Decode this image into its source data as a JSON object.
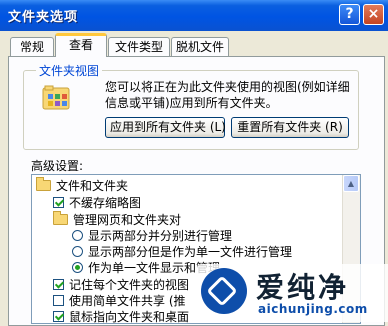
{
  "window": {
    "title": "文件夹选项",
    "help_glyph": "?",
    "close_glyph": "×"
  },
  "tabs": [
    {
      "label": "常规"
    },
    {
      "label": "查看"
    },
    {
      "label": "文件类型"
    },
    {
      "label": "脱机文件"
    }
  ],
  "active_tab": 1,
  "folder_views": {
    "legend": "文件夹视图",
    "description": "您可以将正在为此文件夹使用的视图(例如详细信息或平铺)应用到所有文件夹。",
    "apply_button": "应用到所有文件夹 (L)",
    "reset_button": "重置所有文件夹 (R)"
  },
  "advanced": {
    "label": "高级设置:",
    "items": [
      {
        "type": "folder",
        "label": "文件和文件夹",
        "indent": 0
      },
      {
        "type": "checkbox",
        "label": "不缓存缩略图",
        "checked": true,
        "indent": 1
      },
      {
        "type": "folder",
        "label": "管理网页和文件夹对",
        "indent": 1
      },
      {
        "type": "radio",
        "label": "显示两部分并分别进行管理",
        "checked": false,
        "indent": 2
      },
      {
        "type": "radio",
        "label": "显示两部分但是作为单一文件进行管理",
        "checked": false,
        "indent": 2
      },
      {
        "type": "radio",
        "label": "作为单一文件显示和管理",
        "checked": true,
        "indent": 2
      },
      {
        "type": "checkbox",
        "label": "记住每个文件夹的视图",
        "checked": true,
        "indent": 1
      },
      {
        "type": "checkbox",
        "label": "使用简单文件共享 (推",
        "checked": false,
        "indent": 1
      },
      {
        "type": "checkbox",
        "label": "鼠标指向文件夹和桌面",
        "checked": true,
        "indent": 1
      }
    ]
  },
  "watermark": {
    "text": "爱纯净",
    "url": "aichunjing.com"
  },
  "colors": {
    "titlebar": "#0054E3",
    "accent_tab": "#FFC83C",
    "legend": "#0046D5",
    "check": "#21A121"
  }
}
